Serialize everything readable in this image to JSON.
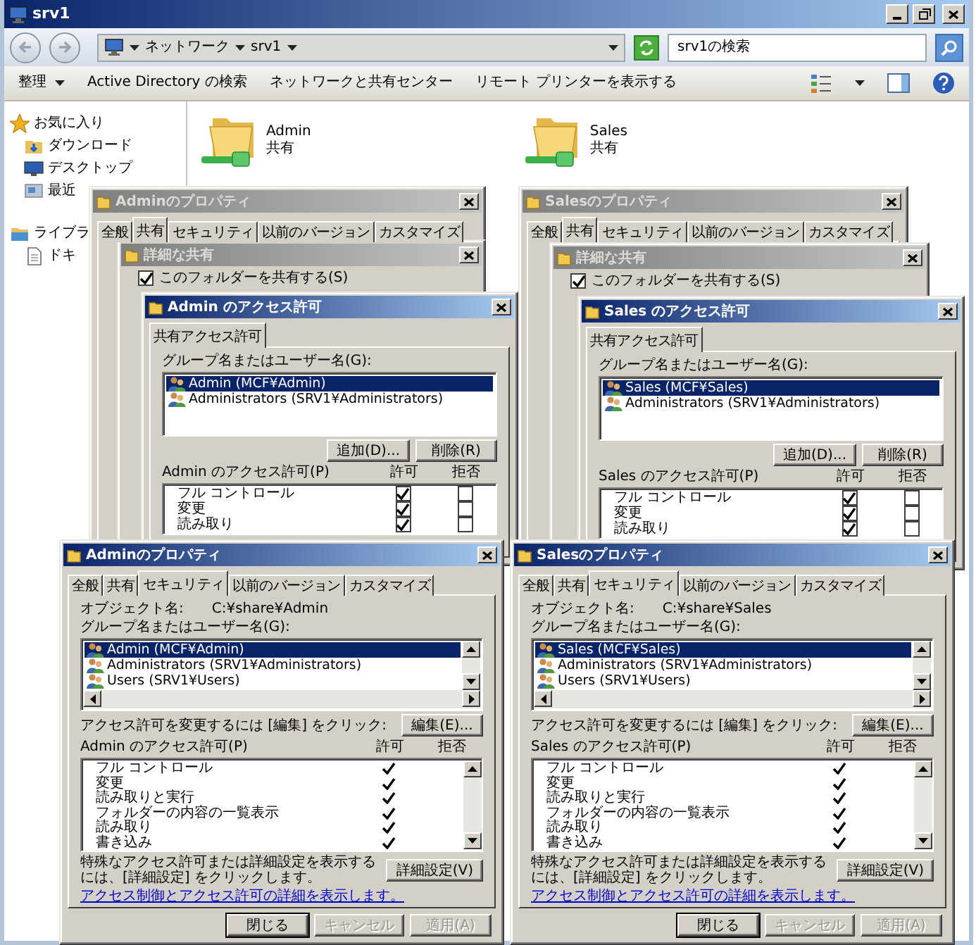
{
  "explorer": {
    "title": "srv1",
    "path": [
      "ネットワーク",
      "srv1"
    ],
    "search": {
      "placeholder": "srv1の検索"
    },
    "toolbar": [
      {
        "label": "整理",
        "kind": "menu"
      },
      {
        "label": "Active Directory の検索",
        "kind": "command"
      },
      {
        "label": "ネットワークと共有センター",
        "kind": "command"
      },
      {
        "label": "リモート プリンターを表示する",
        "kind": "command"
      }
    ],
    "nav": [
      {
        "label": "お気に入り",
        "children": [
          {
            "label": "ダウンロード"
          },
          {
            "label": "デスクトップ"
          },
          {
            "label": "最近"
          }
        ]
      },
      {
        "label": "ライブラ",
        "children": [
          {
            "label": "ドキ"
          }
        ]
      }
    ],
    "items": [
      {
        "name": "Admin",
        "type": "共有"
      },
      {
        "name": "Sales",
        "type": "共有"
      }
    ]
  },
  "sharing": [
    {
      "properties": {
        "title": "Adminのプロパティ",
        "active": false,
        "tabs": [
          {
            "label": "全般",
            "selected": false
          },
          {
            "label": "共有",
            "selected": true
          },
          {
            "label": "セキュリティ",
            "selected": false
          },
          {
            "label": "以前のバージョン",
            "selected": false
          },
          {
            "label": "カスタマイズ",
            "selected": false
          }
        ]
      },
      "advanced": {
        "title": "詳細な共有",
        "active": false,
        "share": {
          "label": "このフォルダーを共有する(S)",
          "checked": true
        }
      },
      "permissions": {
        "title": "Admin のアクセス許可",
        "active": true,
        "tabs": [
          {
            "label": "共有アクセス許可",
            "selected": true
          }
        ],
        "group_label": "グループ名またはユーザー名(G):",
        "principals": [
          {
            "name": "Admin (MCF¥Admin)",
            "selected": true
          },
          {
            "name": "Administrators (SRV1¥Administrators)",
            "selected": false
          }
        ],
        "buttons": [
          "追加(D)...",
          "削除(R)"
        ],
        "perm_label": "Admin のアクセス許可(P)",
        "columns": [
          "許可",
          "拒否"
        ],
        "perms": [
          {
            "name": "フル コントロール",
            "allow": true,
            "deny": false
          },
          {
            "name": "変更",
            "allow": true,
            "deny": false
          },
          {
            "name": "読み取り",
            "allow": true,
            "deny": false
          }
        ]
      }
    },
    {
      "properties": {
        "title": "Salesのプロパティ",
        "active": false,
        "tabs": [
          {
            "label": "全般",
            "selected": false
          },
          {
            "label": "共有",
            "selected": true
          },
          {
            "label": "セキュリティ",
            "selected": false
          },
          {
            "label": "以前のバージョン",
            "selected": false
          },
          {
            "label": "カスタマイズ",
            "selected": false
          }
        ]
      },
      "advanced": {
        "title": "詳細な共有",
        "active": false,
        "share": {
          "label": "このフォルダーを共有する(S)",
          "checked": true
        }
      },
      "permissions": {
        "title": "Sales のアクセス許可",
        "active": true,
        "tabs": [
          {
            "label": "共有アクセス許可",
            "selected": true
          }
        ],
        "group_label": "グループ名またはユーザー名(G):",
        "principals": [
          {
            "name": "Sales (MCF¥Sales)",
            "selected": true
          },
          {
            "name": "Administrators (SRV1¥Administrators)",
            "selected": false
          }
        ],
        "buttons": [
          "追加(D)...",
          "削除(R)"
        ],
        "perm_label": "Sales のアクセス許可(P)",
        "columns": [
          "許可",
          "拒否"
        ],
        "perms": [
          {
            "name": "フル コントロール",
            "allow": true,
            "deny": false
          },
          {
            "name": "変更",
            "allow": true,
            "deny": false
          },
          {
            "name": "読み取り",
            "allow": true,
            "deny": false
          }
        ]
      }
    }
  ],
  "security": [
    {
      "title": "Adminのプロパティ",
      "active": true,
      "tabs": [
        {
          "label": "全般",
          "selected": false
        },
        {
          "label": "共有",
          "selected": false
        },
        {
          "label": "セキュリティ",
          "selected": true
        },
        {
          "label": "以前のバージョン",
          "selected": false
        },
        {
          "label": "カスタマイズ",
          "selected": false
        }
      ],
      "object_label": "オブジェクト名:",
      "object_value": "C:¥share¥Admin",
      "group_label": "グループ名またはユーザー名(G):",
      "principals": [
        {
          "name": "Admin (MCF¥Admin)",
          "selected": true
        },
        {
          "name": "Administrators (SRV1¥Administrators)",
          "selected": false
        },
        {
          "name": "Users (SRV1¥Users)",
          "selected": false
        }
      ],
      "edit_hint": "アクセス許可を変更するには [編集] をクリック:",
      "edit_button": "編集(E)...",
      "perm_label": "Admin のアクセス許可(P)",
      "columns": [
        "許可",
        "拒否"
      ],
      "perms": [
        {
          "name": "フル コントロール",
          "allow": true,
          "deny": false
        },
        {
          "name": "変更",
          "allow": true,
          "deny": false
        },
        {
          "name": "読み取りと実行",
          "allow": true,
          "deny": false
        },
        {
          "name": "フォルダーの内容の一覧表示",
          "allow": true,
          "deny": false
        },
        {
          "name": "読み取り",
          "allow": true,
          "deny": false
        },
        {
          "name": "書き込み",
          "allow": true,
          "deny": false
        }
      ],
      "advanced_hint": "特殊なアクセス許可または詳細設定を表示するには、[詳細設定] をクリックします。",
      "advanced_button": "詳細設定(V)",
      "link": "アクセス制御とアクセス許可の詳細を表示します。",
      "buttons": [
        {
          "label": "閉じる",
          "disabled": false,
          "default": true
        },
        {
          "label": "キャンセル",
          "disabled": true,
          "default": false
        },
        {
          "label": "適用(A)",
          "disabled": true,
          "default": false
        }
      ]
    },
    {
      "title": "Salesのプロパティ",
      "active": true,
      "tabs": [
        {
          "label": "全般",
          "selected": false
        },
        {
          "label": "共有",
          "selected": false
        },
        {
          "label": "セキュリティ",
          "selected": true
        },
        {
          "label": "以前のバージョン",
          "selected": false
        },
        {
          "label": "カスタマイズ",
          "selected": false
        }
      ],
      "object_label": "オブジェクト名:",
      "object_value": "C:¥share¥Sales",
      "group_label": "グループ名またはユーザー名(G):",
      "principals": [
        {
          "name": "Sales (MCF¥Sales)",
          "selected": true
        },
        {
          "name": "Administrators (SRV1¥Administrators)",
          "selected": false
        },
        {
          "name": "Users (SRV1¥Users)",
          "selected": false
        }
      ],
      "edit_hint": "アクセス許可を変更するには [編集] をクリック:",
      "edit_button": "編集(E)...",
      "perm_label": "Sales のアクセス許可(P)",
      "columns": [
        "許可",
        "拒否"
      ],
      "perms": [
        {
          "name": "フル コントロール",
          "allow": true,
          "deny": false
        },
        {
          "name": "変更",
          "allow": true,
          "deny": false
        },
        {
          "name": "読み取りと実行",
          "allow": true,
          "deny": false
        },
        {
          "name": "フォルダーの内容の一覧表示",
          "allow": true,
          "deny": false
        },
        {
          "name": "読み取り",
          "allow": true,
          "deny": false
        },
        {
          "name": "書き込み",
          "allow": true,
          "deny": false
        }
      ],
      "advanced_hint": "特殊なアクセス許可または詳細設定を表示するには、[詳細設定] をクリックします。",
      "advanced_button": "詳細設定(V)",
      "link": "アクセス制御とアクセス許可の詳細を表示します。",
      "buttons": [
        {
          "label": "閉じる",
          "disabled": false,
          "default": true
        },
        {
          "label": "キャンセル",
          "disabled": true,
          "default": false
        },
        {
          "label": "適用(A)",
          "disabled": true,
          "default": false
        }
      ]
    }
  ]
}
